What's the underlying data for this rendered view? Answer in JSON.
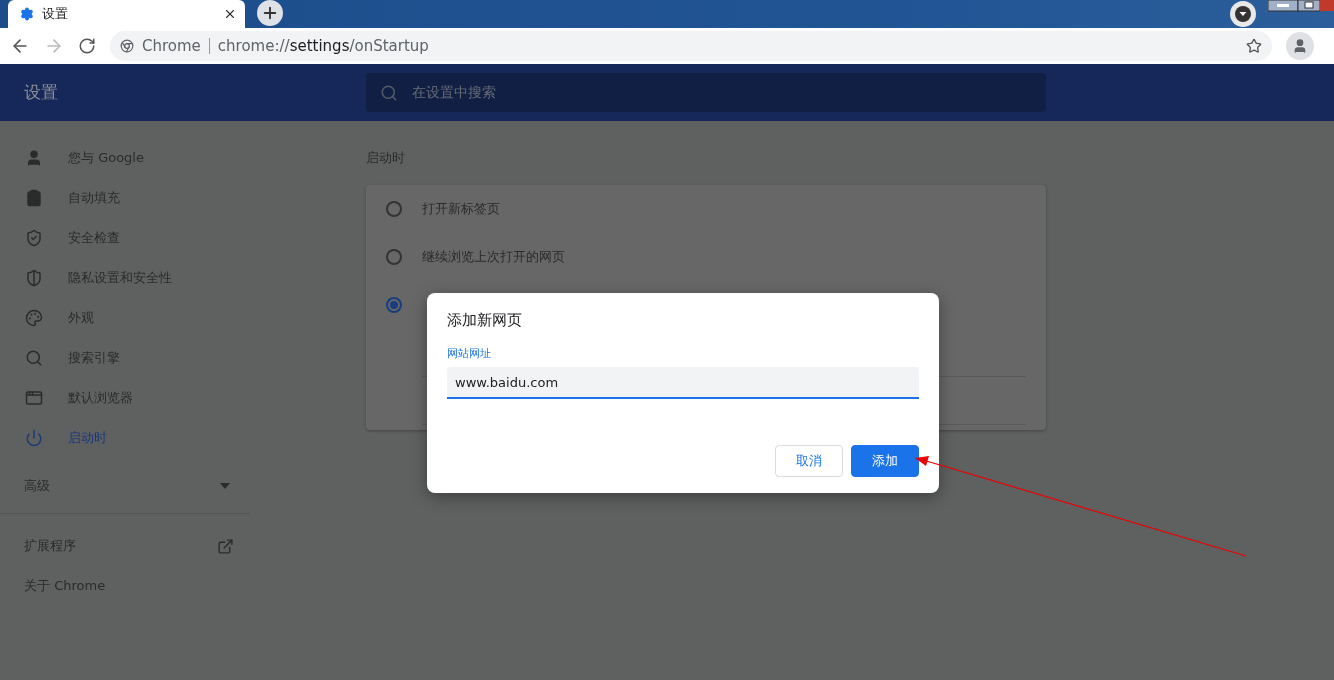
{
  "tab": {
    "title": "设置"
  },
  "address": {
    "site_label": "Chrome",
    "url_prefix": "chrome://",
    "url_host": "settings",
    "url_suffix": "/onStartup"
  },
  "header": {
    "title": "设置",
    "search": {
      "placeholder": "在设置中搜索"
    }
  },
  "sidebar": {
    "items": [
      {
        "label": "您与 Google",
        "selected": false
      },
      {
        "label": "自动填充",
        "selected": false
      },
      {
        "label": "安全检查",
        "selected": false
      },
      {
        "label": "隐私设置和安全性",
        "selected": false
      },
      {
        "label": "外观",
        "selected": false
      },
      {
        "label": "搜索引擎",
        "selected": false
      },
      {
        "label": "默认浏览器",
        "selected": false
      },
      {
        "label": "启动时",
        "selected": true
      }
    ],
    "advanced": {
      "label": "高级",
      "expanded": false
    },
    "links": [
      {
        "label": "扩展程序",
        "kind": "external"
      },
      {
        "label": "关于 Chrome",
        "kind": "plain"
      }
    ]
  },
  "section": {
    "title": "启动时",
    "options": [
      {
        "label": "打开新标签页",
        "selected": false
      },
      {
        "label": "继续浏览上次打开的网页",
        "selected": false
      },
      {
        "selected": true
      }
    ]
  },
  "dialog": {
    "title": "添加新网页",
    "field": {
      "label": "网站网址",
      "value": "www.baidu.com"
    },
    "buttons": [
      {
        "label": "取消",
        "kind": "secondary"
      },
      {
        "label": "添加",
        "kind": "primary"
      }
    ]
  }
}
